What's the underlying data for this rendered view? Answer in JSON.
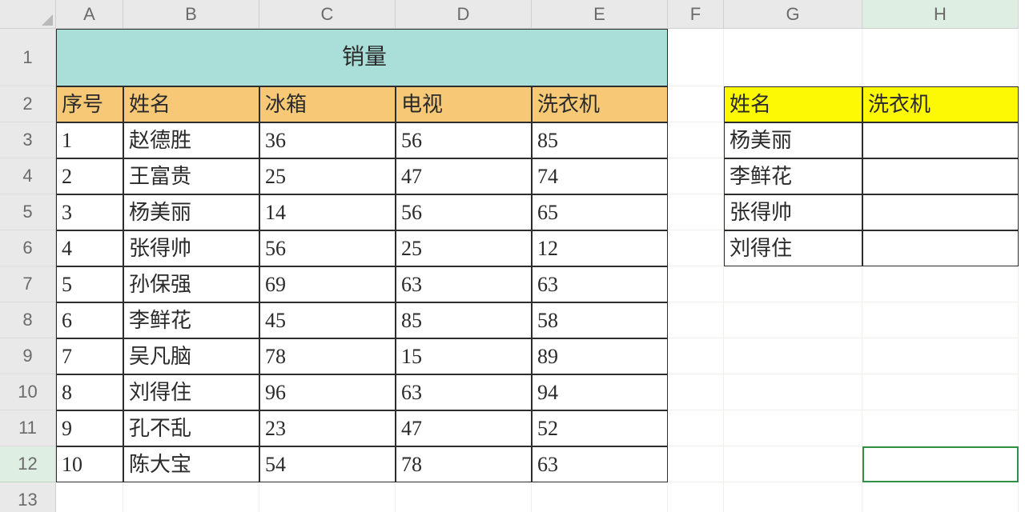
{
  "columns": [
    "A",
    "B",
    "C",
    "D",
    "E",
    "F",
    "G",
    "H"
  ],
  "row_labels": [
    "1",
    "2",
    "3",
    "4",
    "5",
    "6",
    "7",
    "8",
    "9",
    "10",
    "11",
    "12",
    "13"
  ],
  "merged_title": "销量",
  "main_headers": {
    "A": "序号",
    "B": "姓名",
    "C": "冰箱",
    "D": "电视",
    "E": "洗衣机"
  },
  "main_rows": [
    {
      "A": "1",
      "B": "赵德胜",
      "C": "36",
      "D": "56",
      "E": "85"
    },
    {
      "A": "2",
      "B": "王富贵",
      "C": "25",
      "D": "47",
      "E": "74"
    },
    {
      "A": "3",
      "B": "杨美丽",
      "C": "14",
      "D": "56",
      "E": "65"
    },
    {
      "A": "4",
      "B": "张得帅",
      "C": "56",
      "D": "25",
      "E": "12"
    },
    {
      "A": "5",
      "B": "孙保强",
      "C": "69",
      "D": "63",
      "E": "63"
    },
    {
      "A": "6",
      "B": "李鲜花",
      "C": "45",
      "D": "85",
      "E": "58"
    },
    {
      "A": "7",
      "B": "吴凡脑",
      "C": "78",
      "D": "15",
      "E": "89"
    },
    {
      "A": "8",
      "B": "刘得住",
      "C": "96",
      "D": "63",
      "E": "94"
    },
    {
      "A": "9",
      "B": "孔不乱",
      "C": "23",
      "D": "47",
      "E": "52"
    },
    {
      "A": "10",
      "B": "陈大宝",
      "C": "54",
      "D": "78",
      "E": "63"
    }
  ],
  "side_headers": {
    "G": "姓名",
    "H": "洗衣机"
  },
  "side_rows": [
    {
      "G": "杨美丽",
      "H": ""
    },
    {
      "G": "李鲜花",
      "H": ""
    },
    {
      "G": "张得帅",
      "H": ""
    },
    {
      "G": "刘得住",
      "H": ""
    }
  ],
  "active_cell": {
    "col": "H",
    "row": 12
  }
}
